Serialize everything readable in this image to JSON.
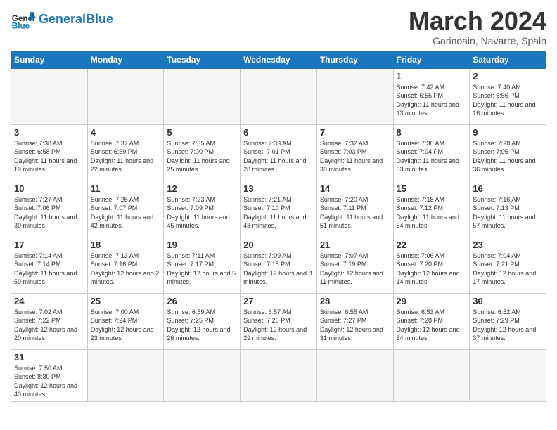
{
  "logo": {
    "text_general": "General",
    "text_blue": "Blue"
  },
  "header": {
    "month": "March 2024",
    "location": "Garinoain, Navarre, Spain"
  },
  "weekdays": [
    "Sunday",
    "Monday",
    "Tuesday",
    "Wednesday",
    "Thursday",
    "Friday",
    "Saturday"
  ],
  "weeks": [
    [
      {
        "day": "",
        "info": ""
      },
      {
        "day": "",
        "info": ""
      },
      {
        "day": "",
        "info": ""
      },
      {
        "day": "",
        "info": ""
      },
      {
        "day": "",
        "info": ""
      },
      {
        "day": "1",
        "info": "Sunrise: 7:42 AM\nSunset: 6:55 PM\nDaylight: 11 hours and 13 minutes."
      },
      {
        "day": "2",
        "info": "Sunrise: 7:40 AM\nSunset: 6:56 PM\nDaylight: 11 hours and 16 minutes."
      }
    ],
    [
      {
        "day": "3",
        "info": "Sunrise: 7:38 AM\nSunset: 6:58 PM\nDaylight: 11 hours and 19 minutes."
      },
      {
        "day": "4",
        "info": "Sunrise: 7:37 AM\nSunset: 6:59 PM\nDaylight: 11 hours and 22 minutes."
      },
      {
        "day": "5",
        "info": "Sunrise: 7:35 AM\nSunset: 7:00 PM\nDaylight: 11 hours and 25 minutes."
      },
      {
        "day": "6",
        "info": "Sunrise: 7:33 AM\nSunset: 7:01 PM\nDaylight: 11 hours and 28 minutes."
      },
      {
        "day": "7",
        "info": "Sunrise: 7:32 AM\nSunset: 7:03 PM\nDaylight: 11 hours and 30 minutes."
      },
      {
        "day": "8",
        "info": "Sunrise: 7:30 AM\nSunset: 7:04 PM\nDaylight: 11 hours and 33 minutes."
      },
      {
        "day": "9",
        "info": "Sunrise: 7:28 AM\nSunset: 7:05 PM\nDaylight: 11 hours and 36 minutes."
      }
    ],
    [
      {
        "day": "10",
        "info": "Sunrise: 7:27 AM\nSunset: 7:06 PM\nDaylight: 11 hours and 39 minutes."
      },
      {
        "day": "11",
        "info": "Sunrise: 7:25 AM\nSunset: 7:07 PM\nDaylight: 11 hours and 42 minutes."
      },
      {
        "day": "12",
        "info": "Sunrise: 7:23 AM\nSunset: 7:09 PM\nDaylight: 11 hours and 45 minutes."
      },
      {
        "day": "13",
        "info": "Sunrise: 7:21 AM\nSunset: 7:10 PM\nDaylight: 11 hours and 48 minutes."
      },
      {
        "day": "14",
        "info": "Sunrise: 7:20 AM\nSunset: 7:11 PM\nDaylight: 11 hours and 51 minutes."
      },
      {
        "day": "15",
        "info": "Sunrise: 7:18 AM\nSunset: 7:12 PM\nDaylight: 11 hours and 54 minutes."
      },
      {
        "day": "16",
        "info": "Sunrise: 7:16 AM\nSunset: 7:13 PM\nDaylight: 11 hours and 57 minutes."
      }
    ],
    [
      {
        "day": "17",
        "info": "Sunrise: 7:14 AM\nSunset: 7:14 PM\nDaylight: 11 hours and 59 minutes."
      },
      {
        "day": "18",
        "info": "Sunrise: 7:13 AM\nSunset: 7:16 PM\nDaylight: 12 hours and 2 minutes."
      },
      {
        "day": "19",
        "info": "Sunrise: 7:11 AM\nSunset: 7:17 PM\nDaylight: 12 hours and 5 minutes."
      },
      {
        "day": "20",
        "info": "Sunrise: 7:09 AM\nSunset: 7:18 PM\nDaylight: 12 hours and 8 minutes."
      },
      {
        "day": "21",
        "info": "Sunrise: 7:07 AM\nSunset: 7:19 PM\nDaylight: 12 hours and 11 minutes."
      },
      {
        "day": "22",
        "info": "Sunrise: 7:06 AM\nSunset: 7:20 PM\nDaylight: 12 hours and 14 minutes."
      },
      {
        "day": "23",
        "info": "Sunrise: 7:04 AM\nSunset: 7:21 PM\nDaylight: 12 hours and 17 minutes."
      }
    ],
    [
      {
        "day": "24",
        "info": "Sunrise: 7:02 AM\nSunset: 7:22 PM\nDaylight: 12 hours and 20 minutes."
      },
      {
        "day": "25",
        "info": "Sunrise: 7:00 AM\nSunset: 7:24 PM\nDaylight: 12 hours and 23 minutes."
      },
      {
        "day": "26",
        "info": "Sunrise: 6:59 AM\nSunset: 7:25 PM\nDaylight: 12 hours and 26 minutes."
      },
      {
        "day": "27",
        "info": "Sunrise: 6:57 AM\nSunset: 7:26 PM\nDaylight: 12 hours and 29 minutes."
      },
      {
        "day": "28",
        "info": "Sunrise: 6:55 AM\nSunset: 7:27 PM\nDaylight: 12 hours and 31 minutes."
      },
      {
        "day": "29",
        "info": "Sunrise: 6:53 AM\nSunset: 7:28 PM\nDaylight: 12 hours and 34 minutes."
      },
      {
        "day": "30",
        "info": "Sunrise: 6:52 AM\nSunset: 7:29 PM\nDaylight: 12 hours and 37 minutes."
      }
    ],
    [
      {
        "day": "31",
        "info": "Sunrise: 7:50 AM\nSunset: 8:30 PM\nDaylight: 12 hours and 40 minutes."
      },
      {
        "day": "",
        "info": ""
      },
      {
        "day": "",
        "info": ""
      },
      {
        "day": "",
        "info": ""
      },
      {
        "day": "",
        "info": ""
      },
      {
        "day": "",
        "info": ""
      },
      {
        "day": "",
        "info": ""
      }
    ]
  ]
}
